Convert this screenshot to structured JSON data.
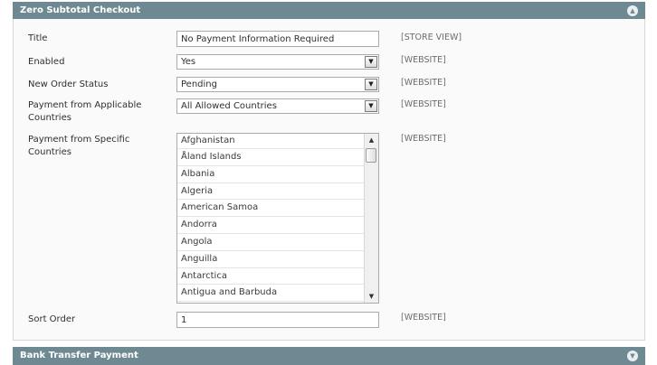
{
  "sections": {
    "zero_subtotal": {
      "title": "Zero Subtotal Checkout",
      "toggle_icon": "chevron-up-icon"
    },
    "bank_transfer": {
      "title": "Bank Transfer Payment",
      "toggle_icon": "chevron-down-icon"
    }
  },
  "fields": {
    "title": {
      "label": "Title",
      "value": "No Payment Information Required",
      "scope": "[STORE VIEW]"
    },
    "enabled": {
      "label": "Enabled",
      "value": "Yes",
      "scope": "[WEBSITE]"
    },
    "new_order_status": {
      "label": "New Order Status",
      "value": "Pending",
      "scope": "[WEBSITE]"
    },
    "applicable_countries": {
      "label": "Payment from Applicable Countries",
      "value": "All Allowed Countries",
      "scope": "[WEBSITE]"
    },
    "specific_countries": {
      "label": "Payment from Specific Countries",
      "scope": "[WEBSITE]",
      "options": [
        "Afghanistan",
        "Åland Islands",
        "Albania",
        "Algeria",
        "American Samoa",
        "Andorra",
        "Angola",
        "Anguilla",
        "Antarctica",
        "Antigua and Barbuda"
      ]
    },
    "sort_order": {
      "label": "Sort Order",
      "value": "1",
      "scope": "[WEBSITE]"
    }
  },
  "icons": {
    "select_arrow": "chevron-down-icon",
    "scroll_up": "scroll-up-arrow-icon",
    "scroll_down": "scroll-down-arrow-icon"
  },
  "colors": {
    "header_bg": "#6f8992",
    "fieldset_bg": "#fafafa",
    "scope_text": "#6c6c6c"
  }
}
